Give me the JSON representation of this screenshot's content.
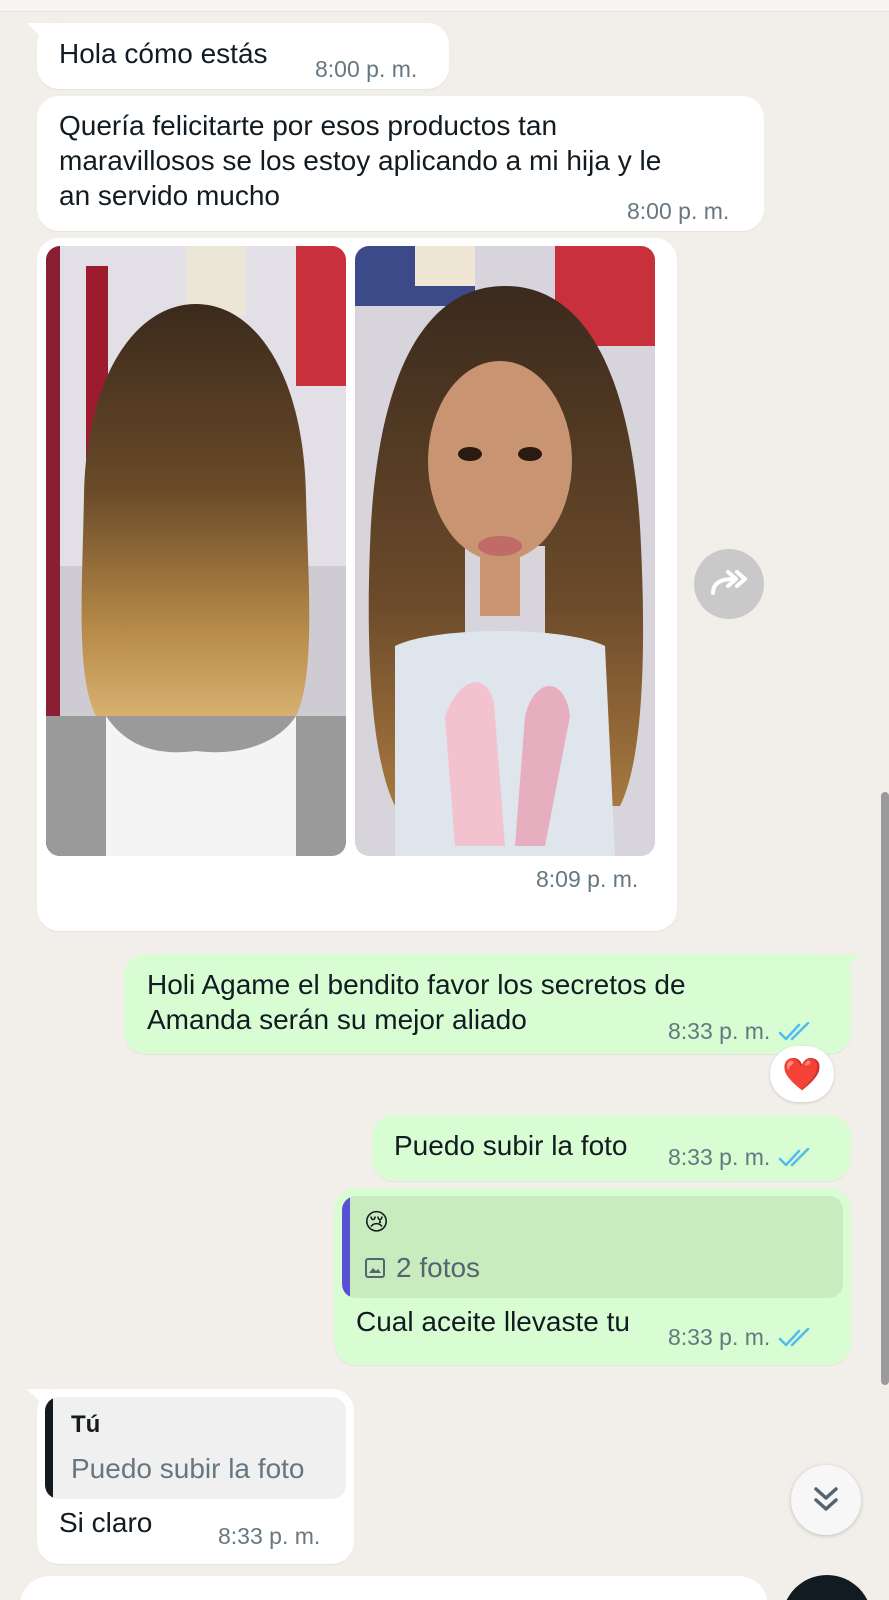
{
  "messages": [
    {
      "text": "Hola cómo estás",
      "time": "8:00 p. m."
    },
    {
      "text": "Quería felicitarte por esos productos tan\nmaravillosos se los estoy aplicando a mi hija y le\nan servido mucho",
      "time": "8:00 p. m."
    },
    {
      "time": "8:09 p. m."
    },
    {
      "text": "Holi Agame el bendito favor los secretos de\nAmanda serán su mejor aliado",
      "time": "8:33 p. m."
    },
    {
      "text": "Puedo subir la foto",
      "time": "8:33 p. m."
    },
    {
      "quote_emoji": "😢",
      "quote_media": "2 fotos",
      "text": "Cual aceite llevaste tu",
      "time": "8:33 p. m."
    },
    {
      "quote_author": "Tú",
      "quote_text": "Puedo subir la foto",
      "text": "Si claro",
      "time": "8:33 p. m."
    }
  ],
  "reaction": "❤️",
  "icons": {
    "forward": "forward-icon",
    "double_check": "double-check-icon",
    "scroll_down": "double-chevron-down-icon",
    "image": "image-icon"
  },
  "colors": {
    "chat_background": "#f2efea",
    "incoming_bubble": "#ffffff",
    "outgoing_bubble": "#d9fdd3",
    "read_check": "#53bdeb",
    "quote_bar_out": "#5b4fd6",
    "quote_bar_in": "#111b21"
  }
}
